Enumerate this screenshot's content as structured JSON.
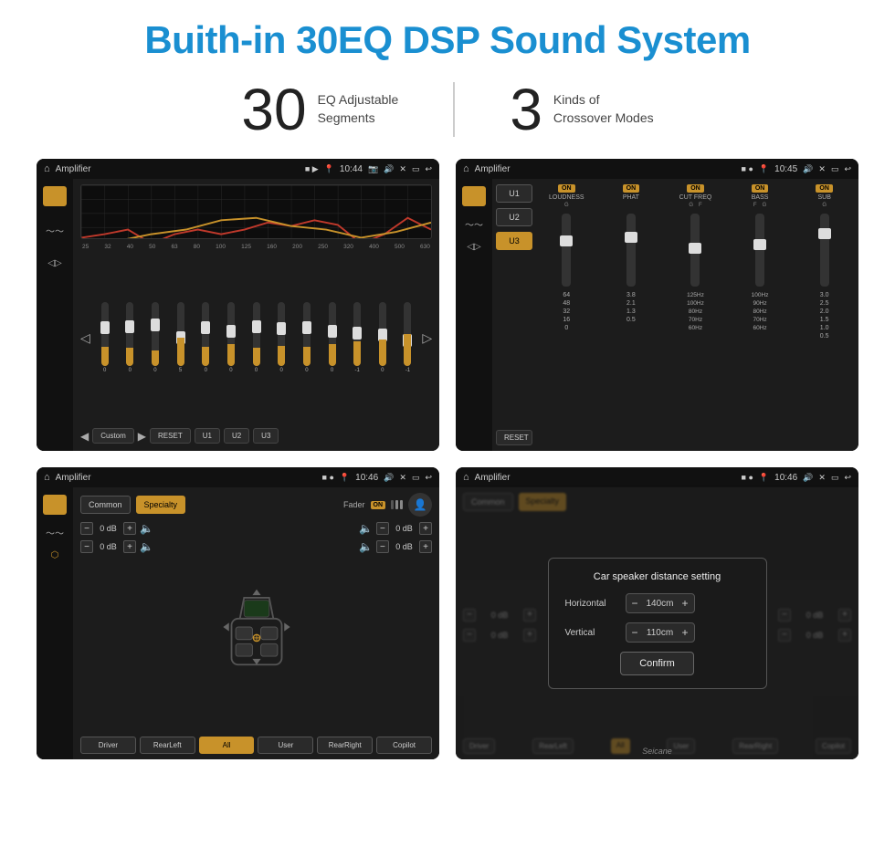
{
  "page": {
    "title": "Buith-in 30EQ DSP Sound System",
    "title_color": "#1a8fd1"
  },
  "features": [
    {
      "number": "30",
      "text_line1": "EQ Adjustable",
      "text_line2": "Segments"
    },
    {
      "number": "3",
      "text_line1": "Kinds of",
      "text_line2": "Crossover Modes"
    }
  ],
  "screens": [
    {
      "id": "screen1",
      "topbar": {
        "title": "Amplifier",
        "time": "10:44"
      },
      "eq_freqs": [
        "25",
        "32",
        "40",
        "50",
        "63",
        "80",
        "100",
        "125",
        "160",
        "200",
        "250",
        "320",
        "400",
        "500",
        "630"
      ],
      "eq_values": [
        "0",
        "0",
        "0",
        "5",
        "0",
        "0",
        "0",
        "0",
        "0",
        "0",
        "-1",
        "0",
        "-1"
      ],
      "bottom_buttons": [
        "RESET",
        "U1",
        "U2",
        "U3"
      ],
      "custom_label": "Custom"
    },
    {
      "id": "screen2",
      "topbar": {
        "title": "Amplifier",
        "time": "10:45"
      },
      "presets": [
        "U1",
        "U2",
        "U3"
      ],
      "active_preset": "U3",
      "channels": [
        {
          "name": "LOUDNESS",
          "on": true,
          "label_g": "G"
        },
        {
          "name": "PHAT",
          "on": true
        },
        {
          "name": "CUT FREQ",
          "on": true,
          "label_g": "G",
          "label_f": "F"
        },
        {
          "name": "BASS",
          "on": true,
          "label_f": "F",
          "label_g": "G"
        },
        {
          "name": "SUB",
          "on": true,
          "label_g": "G"
        }
      ],
      "reset_label": "RESET"
    },
    {
      "id": "screen3",
      "topbar": {
        "title": "Amplifier",
        "time": "10:46"
      },
      "btn_common": "Common",
      "btn_specialty": "Specialty",
      "fader_label": "Fader",
      "fader_on": "ON",
      "controls": {
        "front_left_db": "0 dB",
        "front_right_db": "0 dB",
        "rear_left_db": "0 dB",
        "rear_right_db": "0 dB"
      },
      "bottom_buttons": [
        "Driver",
        "RearLeft",
        "All",
        "User",
        "RearRight",
        "Copilot"
      ],
      "active_btn": "All"
    },
    {
      "id": "screen4",
      "topbar": {
        "title": "Amplifier",
        "time": "10:46"
      },
      "dialog": {
        "title": "Car speaker distance setting",
        "horizontal_label": "Horizontal",
        "horizontal_value": "140cm",
        "vertical_label": "Vertical",
        "vertical_value": "110cm",
        "confirm_label": "Confirm"
      },
      "watermark": "Seicane"
    }
  ]
}
